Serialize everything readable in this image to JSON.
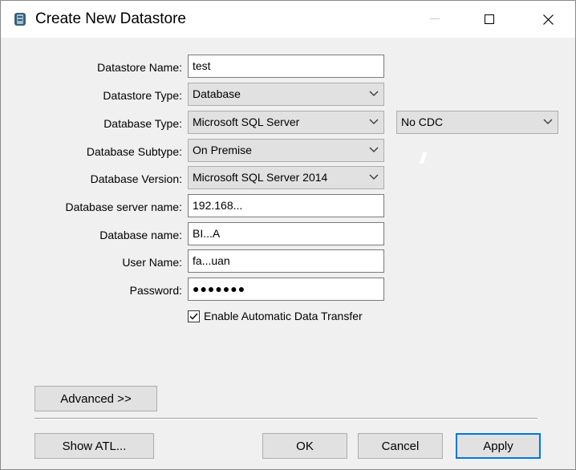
{
  "window": {
    "title": "Create New Datastore"
  },
  "form": {
    "datastore_name": {
      "label": "Datastore Name:",
      "value": "test"
    },
    "datastore_type": {
      "label": "Datastore Type:",
      "value": "Database"
    },
    "database_type": {
      "label": "Database Type:",
      "value": "Microsoft SQL Server",
      "cdc_value": "No CDC"
    },
    "database_subtype": {
      "label": "Database Subtype:",
      "value": "On Premise"
    },
    "database_version": {
      "label": "Database Version:",
      "value": "Microsoft SQL Server 2014"
    },
    "server_name": {
      "label": "Database server name:",
      "value": "192.168..."
    },
    "database_name": {
      "label": "Database name:",
      "value": "BI...A"
    },
    "user_name": {
      "label": "User Name:",
      "value": "fa...uan"
    },
    "password": {
      "label": "Password:",
      "value": "●●●●●●●"
    },
    "auto_transfer": {
      "label": "Enable Automatic Data Transfer",
      "checked": true
    }
  },
  "buttons": {
    "advanced": "Advanced >>",
    "show_atl": "Show ATL...",
    "ok": "OK",
    "cancel": "Cancel",
    "apply": "Apply"
  },
  "colors": {
    "focus_border": "#0078d7",
    "button_face": "#e1e1e1",
    "title_bg": "#ffffff"
  }
}
